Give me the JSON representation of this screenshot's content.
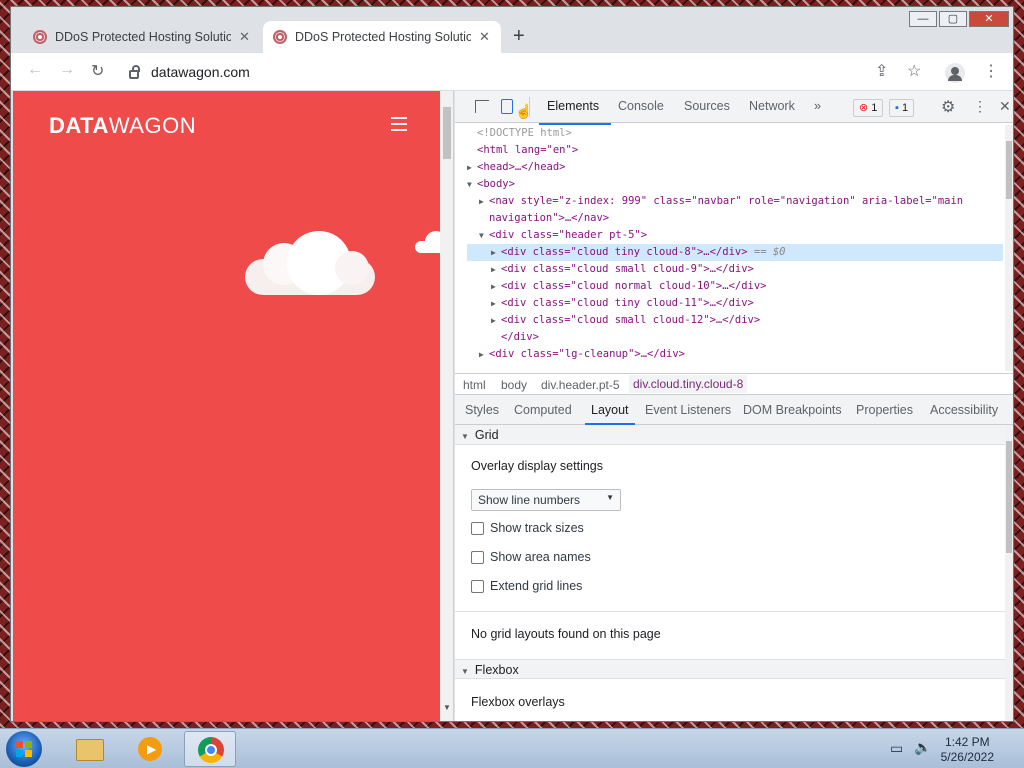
{
  "window": {
    "minimize": "—",
    "maximize": "▢",
    "close": "✕"
  },
  "tabs": [
    {
      "title": "DDoS Protected Hosting Solution",
      "close": "✕"
    },
    {
      "title": "DDoS Protected Hosting Solution",
      "close": "✕"
    }
  ],
  "new_tab": "+",
  "toolbar": {
    "back": "←",
    "forward": "→",
    "reload": "↻",
    "url": "datawagon.com",
    "share": "⇪",
    "star": "☆",
    "menu": "⋮"
  },
  "site": {
    "logo_bold": "DATA",
    "logo_light": "WAGON",
    "bg_color": "#ef4b4b"
  },
  "devtools": {
    "tabs": [
      "Elements",
      "Console",
      "Sources",
      "Network"
    ],
    "more": "»",
    "errors": "1",
    "messages": "1",
    "close": "✕",
    "code": [
      {
        "pre": "",
        "text": "<!DOCTYPE html>",
        "dim": true
      },
      {
        "pre": "",
        "text": "<html lang=\"en\">"
      },
      {
        "pre": "▶",
        "text": "<head>…</head>"
      },
      {
        "pre": "▼",
        "text": "<body>"
      },
      {
        "pre": "▶",
        "text": "<nav style=\"z-index: 999\" class=\"navbar\" role=\"navigation\" aria-label=\"main"
      },
      {
        "pre": "",
        "text": "navigation\">…</nav>"
      },
      {
        "pre": "▼",
        "text": "<div class=\"header pt-5\">"
      },
      {
        "pre": "▶",
        "text": "<div class=\"cloud tiny cloud-8\">…</div>",
        "suffix": "== $0",
        "selected": true
      },
      {
        "pre": "▶",
        "text": "<div class=\"cloud small cloud-9\">…</div>"
      },
      {
        "pre": "▶",
        "text": "<div class=\"cloud normal cloud-10\">…</div>"
      },
      {
        "pre": "▶",
        "text": "<div class=\"cloud tiny cloud-11\">…</div>"
      },
      {
        "pre": "▶",
        "text": "<div class=\"cloud small cloud-12\">…</div>"
      },
      {
        "pre": "",
        "text": "</div>"
      },
      {
        "pre": "▶",
        "text": "<div class=\"lg-cleanup\">…</div>"
      }
    ],
    "breadcrumbs": [
      "html",
      "body",
      "div.header.pt-5",
      "div.cloud.tiny.cloud-8"
    ],
    "subtabs": [
      "Styles",
      "Computed",
      "Layout",
      "Event Listeners",
      "DOM Breakpoints",
      "Properties",
      "Accessibility"
    ],
    "layout": {
      "grid_header": "Grid",
      "overlay_title": "Overlay display settings",
      "select_value": "Show line numbers",
      "checkboxes": [
        "Show track sizes",
        "Show area names",
        "Extend grid lines"
      ],
      "no_grid": "No grid layouts found on this page",
      "flexbox_header": "Flexbox",
      "flexbox_overlays": "Flexbox overlays"
    }
  },
  "taskbar": {
    "time": "1:42 PM",
    "date": "5/26/2022"
  }
}
